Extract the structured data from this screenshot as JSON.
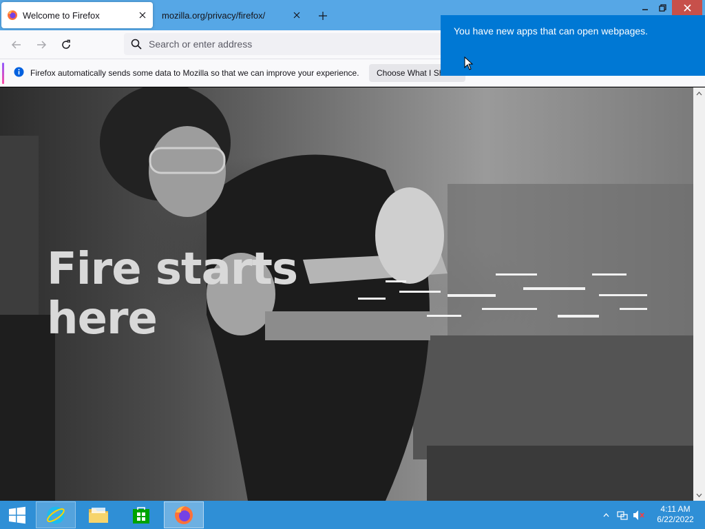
{
  "browser": {
    "tabs": [
      {
        "label": "Welcome to Firefox",
        "active": true
      },
      {
        "label": "mozilla.org/privacy/firefox/",
        "active": false
      }
    ],
    "address_bar": {
      "placeholder": "Search or enter address",
      "value": ""
    },
    "notification": {
      "text": "Firefox automatically sends some data to Mozilla so that we can improve your experience.",
      "button_label": "Choose What I Share"
    },
    "accent_color": "#56a7e6"
  },
  "page": {
    "hero_heading": "Fire starts here"
  },
  "toast": {
    "message": "You have new apps that can open webpages.",
    "color": "#0078d4"
  },
  "taskbar": {
    "pinned": [
      "start-icon",
      "internet-explorer-icon",
      "file-explorer-icon",
      "store-icon",
      "firefox-icon"
    ],
    "clock": {
      "time": "4:11 AM",
      "date": "6/22/2022"
    },
    "color": "#2f8fd6"
  }
}
